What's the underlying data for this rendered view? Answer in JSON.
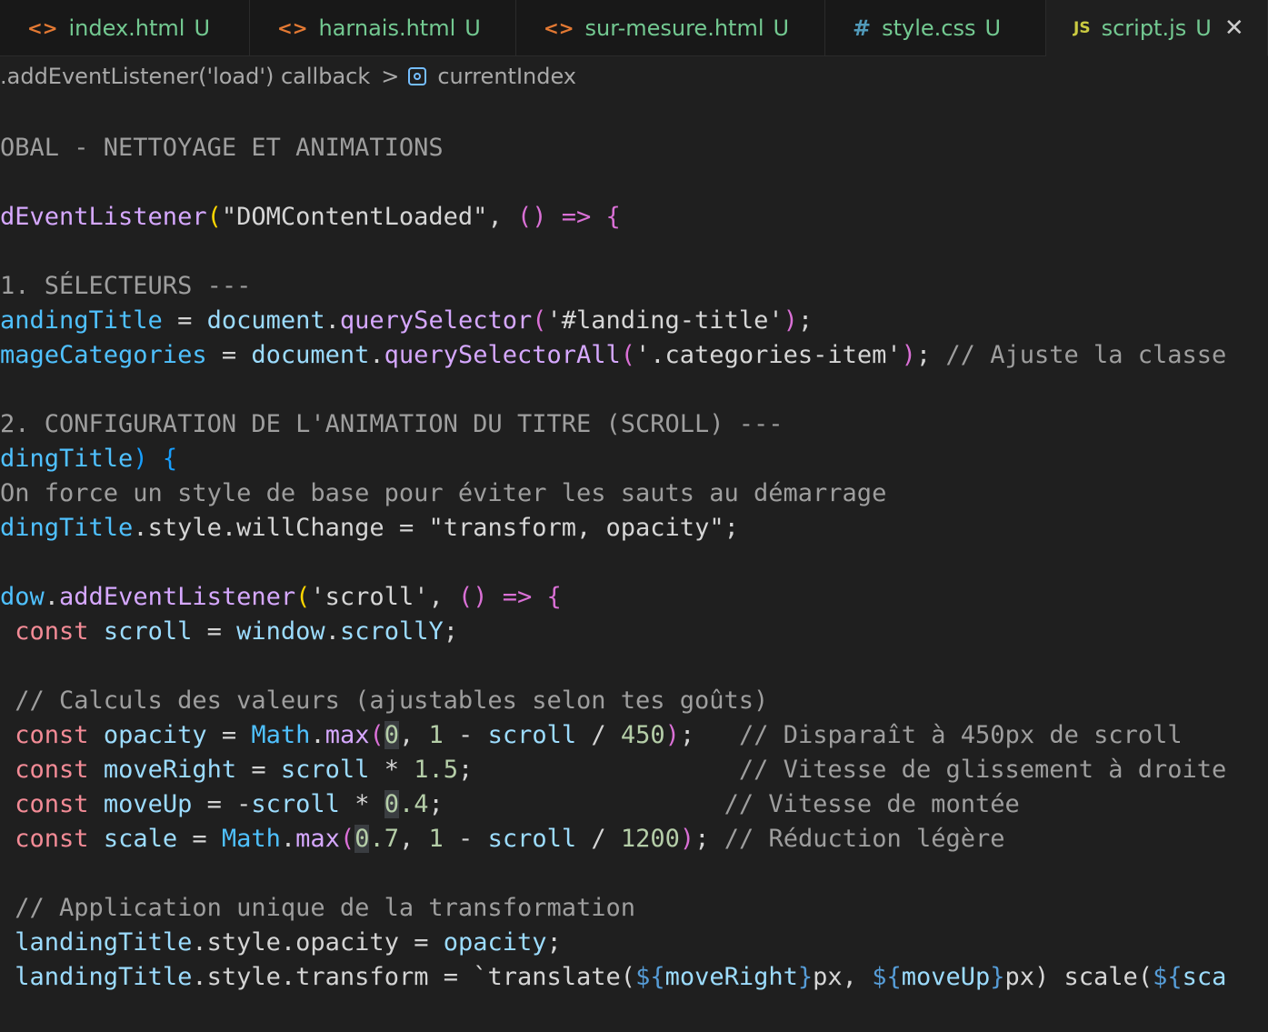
{
  "tabs": [
    {
      "label": "index.html",
      "status": "U",
      "icon": "html-icon",
      "icon_glyph": "<>"
    },
    {
      "label": "harnais.html",
      "status": "U",
      "icon": "html-icon",
      "icon_glyph": "<>"
    },
    {
      "label": "sur-mesure.html",
      "status": "U",
      "icon": "html-icon",
      "icon_glyph": "<>"
    },
    {
      "label": "style.css",
      "status": "U",
      "icon": "css-icon",
      "icon_glyph": "#"
    },
    {
      "label": "script.js",
      "status": "U",
      "icon": "js-icon",
      "icon_glyph": "JS",
      "active": true,
      "close": "✕"
    }
  ],
  "breadcrumb": {
    "segment1": ".addEventListener('load') callback",
    "separator": ">",
    "segment2": "currentIndex"
  },
  "code": {
    "l1": "OBAL - NETTOYAGE ET ANIMATIONS",
    "l2": [
      "dEventListener",
      "(",
      "\"DOMContentLoaded\"",
      ", ",
      "()",
      " => ",
      "{"
    ],
    "l3": "1. SÉLECTEURS ---",
    "l4": [
      "andingTitle",
      " = ",
      "document",
      ".",
      "querySelector",
      "(",
      "'#landing-title'",
      ")",
      ";"
    ],
    "l5": [
      "mageCategories",
      " = ",
      "document",
      ".",
      "querySelectorAll",
      "(",
      "'.categories-item'",
      ")",
      "; ",
      "// Ajuste la classe"
    ],
    "l6": "2. CONFIGURATION DE L'ANIMATION DU TITRE (SCROLL) ---",
    "l7": [
      "dingTitle",
      ")",
      " ",
      "{"
    ],
    "l8": "On force un style de base pour éviter les sauts au démarrage",
    "l9": [
      "dingTitle",
      ".",
      "style",
      ".",
      "willChange",
      " = ",
      "\"transform, opacity\"",
      ";"
    ],
    "l10": [
      "dow",
      ".",
      "addEventListener",
      "(",
      "'scroll'",
      ", ",
      "()",
      " => ",
      "{"
    ],
    "l11": [
      " ",
      "const",
      " ",
      "scroll",
      " = ",
      "window",
      ".",
      "scrollY",
      ";"
    ],
    "l12": " // Calculs des valeurs (ajustables selon tes goûts)",
    "l13": [
      " ",
      "const",
      " ",
      "opacity",
      " = ",
      "Math",
      ".",
      "max",
      "(",
      "0",
      ", ",
      "1",
      " - ",
      "scroll",
      " / ",
      "450",
      ")",
      ";   ",
      "// Disparaît à 450px de scroll"
    ],
    "l14": [
      " ",
      "const",
      " ",
      "moveRight",
      " = ",
      "scroll",
      " * ",
      "1.5",
      ";                  ",
      "// Vitesse de glissement à droite"
    ],
    "l15": [
      " ",
      "const",
      " ",
      "moveUp",
      " = -",
      "scroll",
      " * ",
      "0",
      ".4",
      ";                   ",
      "// Vitesse de montée"
    ],
    "l16": [
      " ",
      "const",
      " ",
      "scale",
      " = ",
      "Math",
      ".",
      "max",
      "(",
      "0",
      ".7",
      ", ",
      "1",
      " - ",
      "scroll",
      " / ",
      "1200",
      ")",
      "; ",
      "// Réduction légère"
    ],
    "l17": " // Application unique de la transformation",
    "l18": [
      " ",
      "landingTitle",
      ".",
      "style",
      ".",
      "opacity",
      " = ",
      "opacity",
      ";"
    ],
    "l19": [
      " ",
      "landingTitle",
      ".",
      "style",
      ".",
      "transform",
      " = ",
      "`translate(",
      "${",
      "moveRight",
      "}",
      "px, ",
      "${",
      "moveUp",
      "}",
      "px) scale(",
      "${",
      "sca"
    ]
  }
}
